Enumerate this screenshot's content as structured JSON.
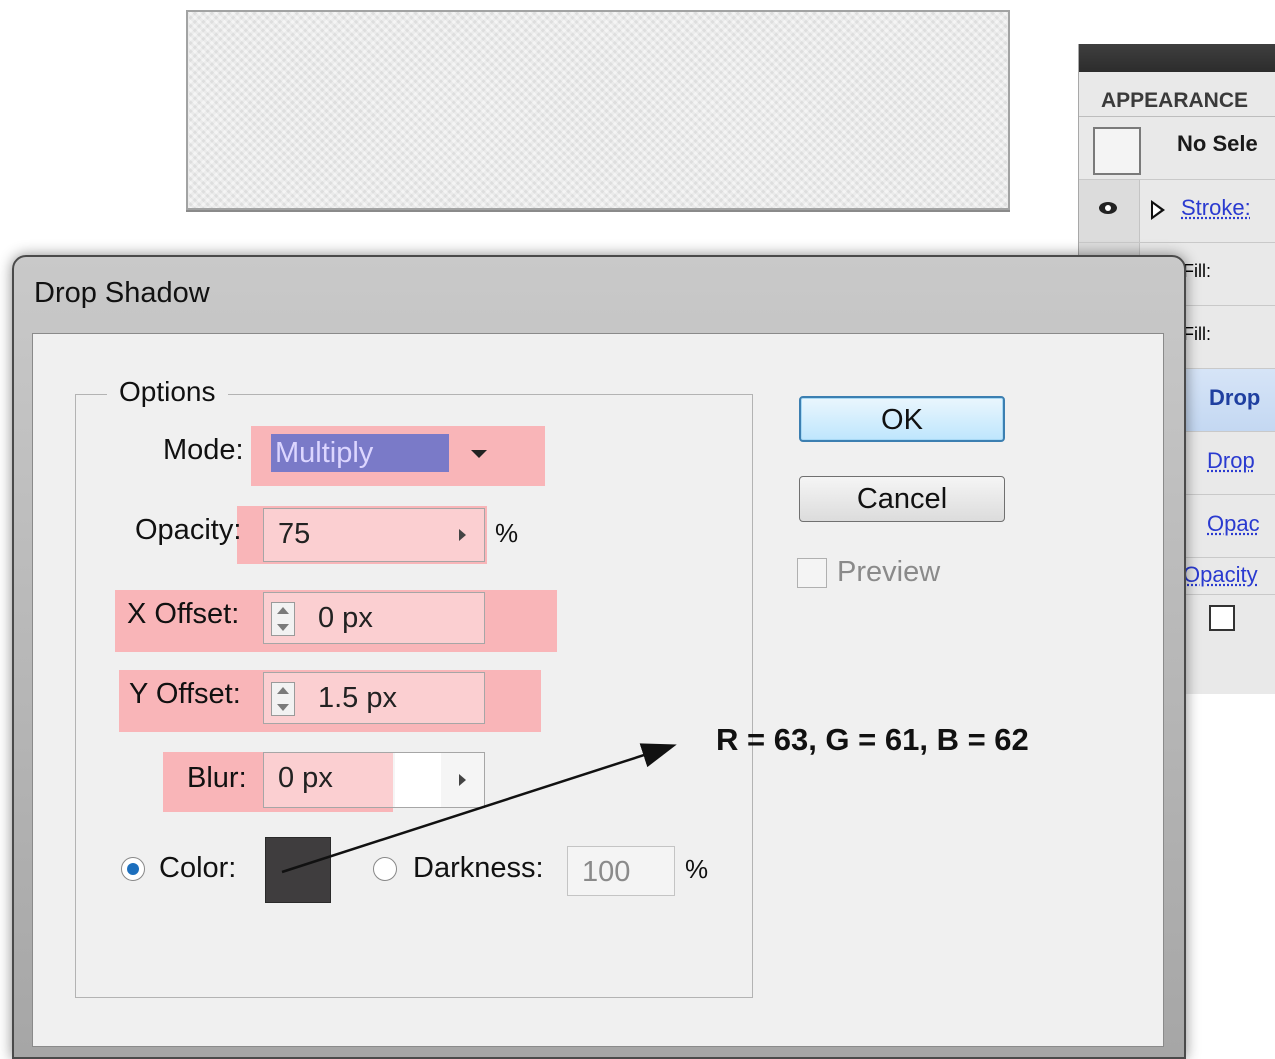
{
  "appearance": {
    "tab": "APPEARANCE",
    "no_selection": "No Sele",
    "stroke": "Stroke:",
    "fill1": "Fill:",
    "fill2": "Fill:",
    "drop_selected": "Drop",
    "drop_link": "Drop",
    "opacity_link": "Opac",
    "opacity_row": "Opacity"
  },
  "dialog": {
    "title": "Drop Shadow",
    "options_legend": "Options",
    "mode": {
      "label": "Mode:",
      "value": "Multiply"
    },
    "opacity": {
      "label": "Opacity:",
      "value": "75",
      "unit": "%"
    },
    "x_offset": {
      "label": "X Offset:",
      "value": "0 px"
    },
    "y_offset": {
      "label": "Y Offset:",
      "value": "1.5 px"
    },
    "blur": {
      "label": "Blur:",
      "value": "0 px"
    },
    "color": {
      "label": "Color:",
      "swatch_color": "#3f3d3e",
      "selected": true
    },
    "darkness": {
      "label": "Darkness:",
      "value": "100",
      "unit": "%",
      "selected": false
    },
    "ok_label": "OK",
    "cancel_label": "Cancel",
    "preview_label": "Preview",
    "preview_checked": false
  },
  "annotation": "R = 63, G = 61, B = 62",
  "colors": {
    "highlight": "#f9aeb1",
    "ok_border": "#3c7fb1",
    "link": "#2a3ad0"
  }
}
